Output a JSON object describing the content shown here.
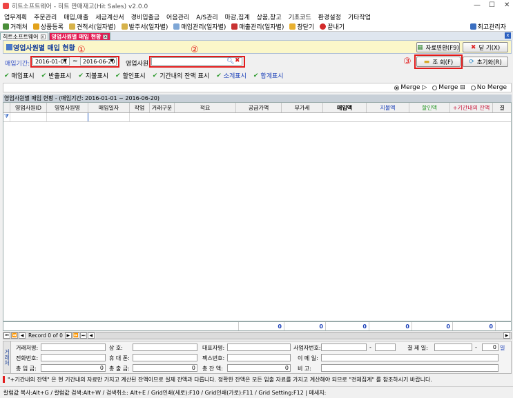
{
  "window": {
    "title": "히트소프트웨어 - 히트 판매재고(Hit Sales) v2.0.0",
    "min": "—",
    "max": "☐",
    "close": "✕"
  },
  "menu": [
    "업무계획",
    "주문관리",
    "매입,매출",
    "세금계산서",
    "경비입출금",
    "어음관리",
    "A/S관리",
    "마감,집계",
    "상품,창고",
    "기초코드",
    "환경설정",
    "기타작업"
  ],
  "toolbar": {
    "items": [
      "거래처",
      "상품등록",
      "견적서(일자별)",
      "발주서(일자별)",
      "매입관리(일자별)",
      "매출관리(일자별)",
      "창닫기",
      "끝내기"
    ],
    "right": "최고관리자"
  },
  "tabs": [
    {
      "label": "히트소프트웨어"
    },
    {
      "label": "영업사원별 매입 현황"
    }
  ],
  "header": {
    "title": "영업사원별 매입 현황",
    "btn_convert": "자료변환(F9)",
    "btn_close": "닫 기(X)"
  },
  "filter": {
    "period_label": "매입기간:",
    "date_from": "2016-01-01",
    "date_sep": "~",
    "date_to": "2016-06-20",
    "rep_label": "영업사원:",
    "rep_value": "",
    "btn_search": "조 회(F)",
    "btn_reset": "초기화(R)",
    "marker1": "①",
    "marker2": "②",
    "marker3": "③"
  },
  "options": [
    "매입표시",
    "반출표시",
    "지불표시",
    "할인표시",
    "기간내의 잔액 표시",
    "소계표시",
    "합계표시"
  ],
  "merge": {
    "opt1": "Merge ▷",
    "opt2": "Merge ⊟",
    "opt3": "No Merge",
    "selected": "opt1"
  },
  "grid": {
    "caption": "영업사원별 매입 현황 - (매입기간: 2016-01-01 ~ 2016-06-20)",
    "columns": [
      "영업사원ID",
      "영업사원명",
      "매입일자",
      "작업",
      "거래구분",
      "적요",
      "공급가액",
      "부가세",
      "매입액",
      "지불액",
      "할인액",
      "+기간내의 잔액",
      "결"
    ],
    "footer": [
      "0",
      "0",
      "0",
      "0",
      "0",
      "0"
    ],
    "record": "Record 0 of 0"
  },
  "info": {
    "side": "거래처",
    "company_label": "거래처명:",
    "ceo_label": "대표자명:",
    "bizno_label": "사업자번호:",
    "dash": "-",
    "settle_label": "결 제 일:",
    "settle_day": "0",
    "settle_unit": "일",
    "tel_label": "전화번호:",
    "mobile_label": "휴 대 폰:",
    "fax_label": "팩스번호:",
    "email_label": "이 메 일:",
    "sale_label": "총 입 금:",
    "sale_value": "0",
    "total_label": "총 출 금:",
    "total_value": "0",
    "balance_label": "총 잔 액:",
    "balance_value": "0",
    "note_label": "비 고:",
    "addr1_label": "상 호:"
  },
  "note": "\"+기간내의 잔액\" 은 현 기간내의 자료만 가지고 계산된 잔액이므로 실제 잔액과 다릅니다. 정확한 잔액은 모든 입출 자료를 가지고 계산해야 되므로 \"전체집계\" 를 참조하시기 바랍니다.",
  "status": "칼럼값 복사:Alt+G / 칼럼값 검색:Alt+W / 검색취소: Alt+E / Grid인쇄(세로):F10 / Grid인쇄(가로):F11 / Grid Setting:F12  | 메세지:"
}
